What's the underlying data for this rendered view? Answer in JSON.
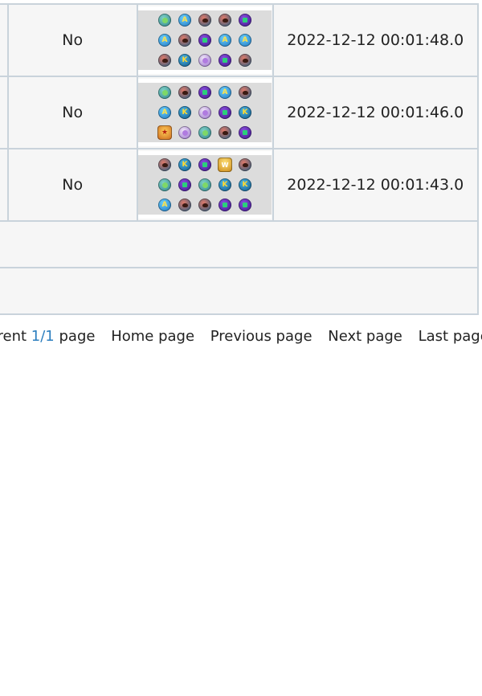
{
  "table": {
    "rows": [
      {
        "flag": "No",
        "datetime": "2022-12-12 00:01:48.0",
        "board": [
          [
            "G",
            "A",
            "R",
            "R",
            "P"
          ],
          [
            "A",
            "R",
            "P",
            "A",
            "A"
          ],
          [
            "R",
            "K",
            "F",
            "P",
            "R"
          ]
        ]
      },
      {
        "flag": "No",
        "datetime": "2022-12-12 00:01:46.0",
        "board": [
          [
            "G",
            "R",
            "P",
            "A",
            "R"
          ],
          [
            "A",
            "K",
            "F",
            "P",
            "K"
          ],
          [
            "S",
            "F",
            "G",
            "R",
            "P"
          ]
        ]
      },
      {
        "flag": "No",
        "datetime": "2022-12-12 00:01:43.0",
        "board": [
          [
            "R",
            "K",
            "P",
            "W",
            "R"
          ],
          [
            "G",
            "P",
            "G",
            "K",
            "K"
          ],
          [
            "A",
            "R",
            "R",
            "P",
            "P"
          ]
        ]
      }
    ],
    "orb_legend": {
      "A": "a-badge-orb",
      "K": "k-badge-orb",
      "P": "purple-orb",
      "G": "green-orb",
      "R": "character-orb",
      "F": "frieza-orb",
      "S": "special-orb",
      "W": "wild-orb"
    }
  },
  "pager": {
    "prefix": "urrent",
    "current": "1/1",
    "suffix": "page",
    "home": "Home page",
    "previous": "Previous page",
    "next": "Next page",
    "last": "Last page"
  },
  "colors": {
    "border": "#c9d3db",
    "cell_bg": "#f6f6f6",
    "page_number": "#2d7fbf"
  }
}
